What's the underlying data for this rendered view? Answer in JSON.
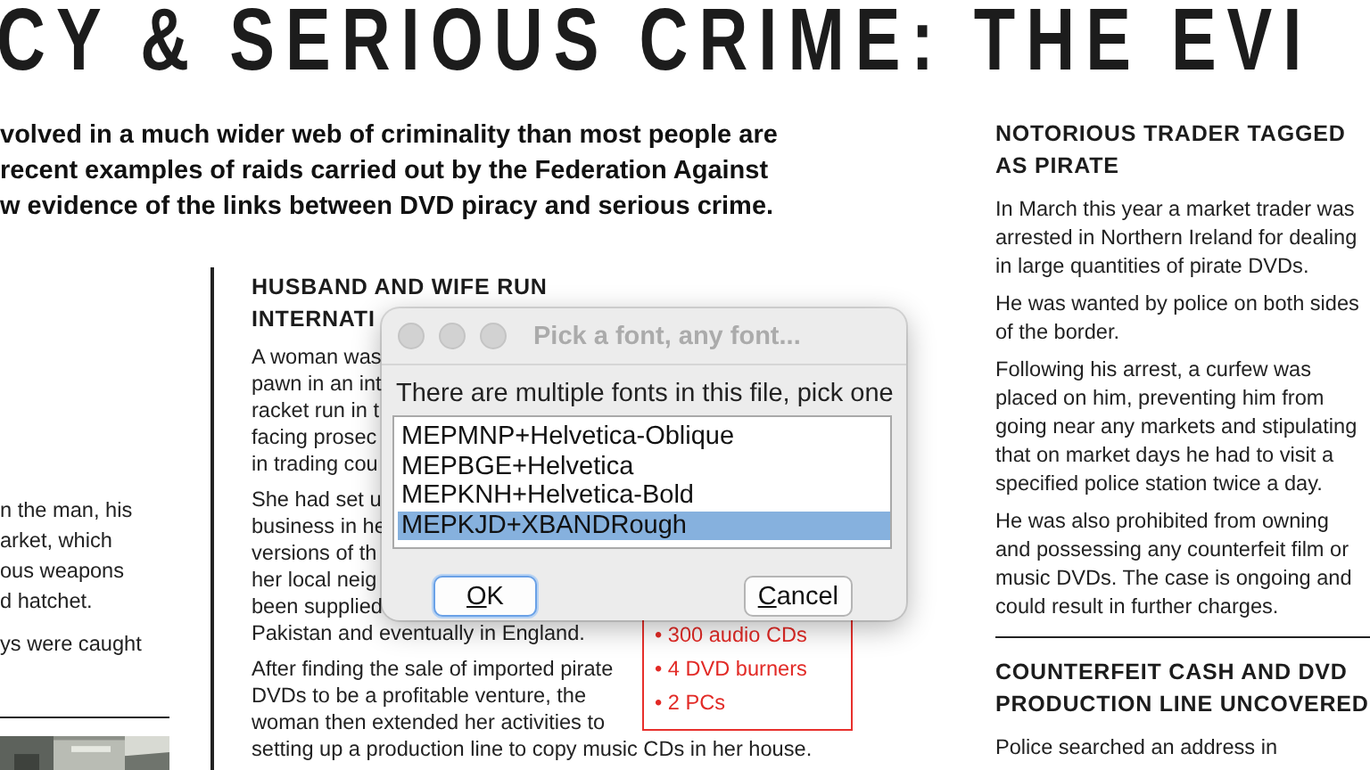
{
  "headline": "CY & SERIOUS CRIME: THE EVI",
  "intro": {
    "lines": [
      "volved in a much wider web of criminality than most people are",
      "recent examples of raids carried out by the Federation Against",
      "w evidence of the links between DVD piracy and serious crime."
    ]
  },
  "left_column": {
    "paragraphs": [
      {
        "lines": [
          "n the man, his",
          "arket, which",
          "ous weapons",
          "d hatchet."
        ]
      },
      {
        "lines": [
          "ys were caught"
        ]
      }
    ]
  },
  "middle_column": {
    "heading_lines": [
      "HUSBAND AND WIFE RUN",
      "INTERNATI"
    ],
    "paragraphs": [
      {
        "lines": [
          "A woman was",
          "pawn in an int",
          "racket run in t",
          "facing prosec",
          "in trading cou"
        ]
      },
      {
        "lines": [
          "She had set u",
          "business in he",
          "versions of th",
          "her local neig",
          "been supplied",
          "Pakistan and eventually in England."
        ]
      },
      {
        "lines": [
          "After finding the sale of imported pirate",
          "DVDs to be a profitable venture, the",
          "woman then extended her activities to",
          "setting up a production line to copy music CDs in her house."
        ]
      }
    ],
    "box": {
      "items": [
        "• 300 audio CDs",
        "• 4 DVD burners",
        "• 2 PCs"
      ]
    }
  },
  "right_column": {
    "sections": [
      {
        "heading_lines": [
          "NOTORIOUS TRADER TAGGED",
          "AS PIRATE"
        ],
        "paragraphs": [
          {
            "lines": [
              "In March this year a market trader was",
              "arrested in Northern Ireland for dealing",
              "in large quantities of pirate DVDs."
            ]
          },
          {
            "lines": [
              "He was wanted by police on both sides",
              "of the border."
            ]
          },
          {
            "lines": [
              "Following his arrest, a curfew was",
              "placed on him, preventing him from",
              "going near any markets and stipulating",
              "that on market days he had to visit a",
              "specified police station twice a day."
            ]
          },
          {
            "lines": [
              "He was also prohibited from owning",
              "and possessing any counterfeit film or",
              "music DVDs. The case is ongoing and",
              "could result in further charges."
            ]
          }
        ]
      },
      {
        "heading_lines": [
          "COUNTERFEIT CASH AND DVD",
          "PRODUCTION LINE UNCOVERED"
        ],
        "paragraphs": [
          {
            "lines": [
              "Police searched an address in"
            ]
          }
        ]
      }
    ]
  },
  "dialog": {
    "title": "Pick a font, any font...",
    "message": "There are multiple fonts in this file, pick one",
    "fonts": [
      {
        "label": "MEPMNP+Helvetica-Oblique",
        "selected": false
      },
      {
        "label": "MEPBGE+Helvetica",
        "selected": false
      },
      {
        "label": "MEPKNH+Helvetica-Bold",
        "selected": false
      },
      {
        "label": "MEPKJD+XBANDRough",
        "selected": true
      }
    ],
    "buttons": [
      {
        "label": "OK",
        "default": true,
        "mnemonic": true
      },
      {
        "label": "Cancel",
        "default": false,
        "mnemonic": true
      }
    ]
  }
}
